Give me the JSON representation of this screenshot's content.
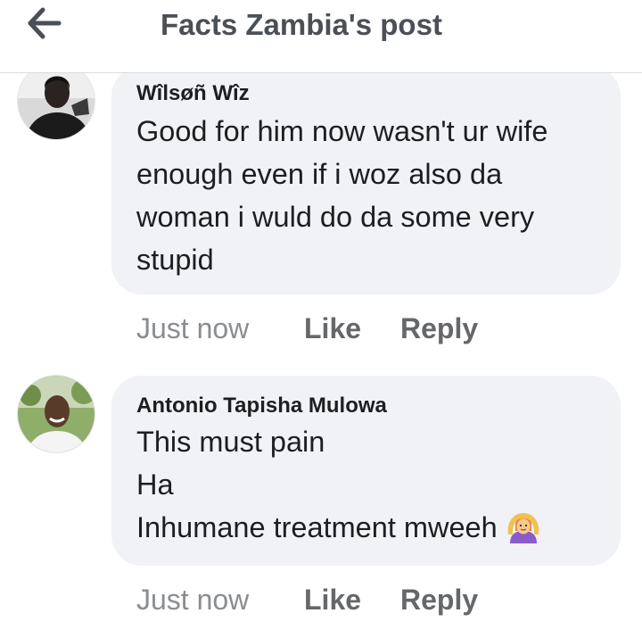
{
  "header": {
    "title": "Facts Zambia's post",
    "back_icon": "arrow-left-icon"
  },
  "colors": {
    "bubble_bg": "#f0f2f5",
    "text_primary": "#1c1e21",
    "text_secondary": "#65676b",
    "header_title": "#4b4f56"
  },
  "comments": [
    {
      "author": "Wîlsøñ Wîz",
      "avatar_icon": "user-avatar-icon",
      "lines": [
        "Good for him now wasn't ur wife",
        "enough even if i woz also da",
        "woman i wuld do da some very",
        "stupid"
      ],
      "time": "Just now",
      "like_label": "Like",
      "reply_label": "Reply"
    },
    {
      "author": "Antonio Tapisha Mulowa",
      "avatar_icon": "user-avatar-icon",
      "lines": [
        "This must pain",
        "Ha",
        "Inhumane treatment mweeh"
      ],
      "emoji_icon": "person-gesturing-ok-emoji",
      "time": "Just now",
      "like_label": "Like",
      "reply_label": "Reply"
    }
  ]
}
